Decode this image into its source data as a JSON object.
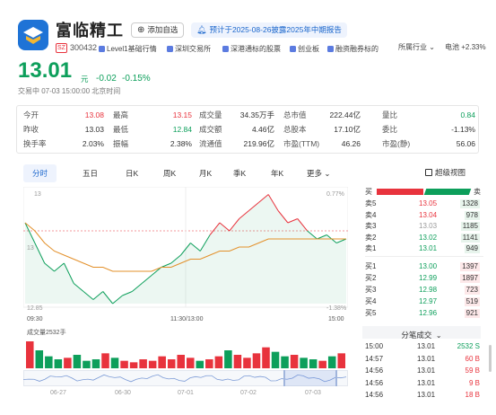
{
  "stock": {
    "name": "富临精工",
    "exchange_badge": "SZ",
    "code": "300432",
    "add_watchlist": "添加自选",
    "report_notice": "预计于2025-08-26披露2025年中期报告",
    "price": "13.01",
    "currency": "元",
    "change": "-0.02",
    "change_pct": "-0.15%",
    "status": "交易中 07-03 15:00:00 北京时间",
    "tags": [
      "Level1基础行情",
      "深圳交易所",
      "深港通标的股票",
      "创业板",
      "融资融券标的"
    ],
    "industry_label": "所属行业",
    "industry_value": "电池 +2.33%",
    "colors": {
      "up": "#e8333d",
      "down": "#0d9f5b",
      "brand": "#1a66cc"
    }
  },
  "stats": [
    [
      {
        "label": "今开",
        "value": "13.08",
        "color": "red"
      },
      {
        "label": "最高",
        "value": "13.15",
        "color": "red"
      },
      {
        "label": "成交量",
        "value": "34.35万手",
        "color": ""
      },
      {
        "label": "总市值",
        "value": "222.44亿",
        "color": ""
      },
      {
        "label": "量比",
        "value": "0.84",
        "color": "green"
      }
    ],
    [
      {
        "label": "昨收",
        "value": "13.03",
        "color": ""
      },
      {
        "label": "最低",
        "value": "12.84",
        "color": "green"
      },
      {
        "label": "成交额",
        "value": "4.46亿",
        "color": ""
      },
      {
        "label": "总股本",
        "value": "17.10亿",
        "color": ""
      },
      {
        "label": "委比",
        "value": "-1.13%",
        "color": ""
      }
    ],
    [
      {
        "label": "换手率",
        "value": "2.03%",
        "color": ""
      },
      {
        "label": "振幅",
        "value": "2.38%",
        "color": ""
      },
      {
        "label": "流通值",
        "value": "219.96亿",
        "color": ""
      },
      {
        "label": "市盈(TTM)",
        "value": "46.26",
        "color": ""
      },
      {
        "label": "市盈(静)",
        "value": "56.06",
        "color": ""
      }
    ]
  ],
  "chart_tabs": [
    "分时",
    "五日",
    "日K",
    "周K",
    "月K",
    "季K",
    "年K",
    "更多"
  ],
  "super_view": "超级视图",
  "chart_labels": {
    "y_top": "13",
    "y_mid": "13",
    "y_bot": "12.85",
    "pct_top": "0.77%",
    "pct_bot": "-1.38%",
    "x_start": "09:30",
    "x_mid": "11:30/13:00",
    "x_end": "15:00",
    "volume_label": "成交量2532手",
    "mini_dates": [
      "06-27",
      "06-30",
      "07-01",
      "07-02",
      "07-03"
    ]
  },
  "chart_data": {
    "type": "line",
    "series": [
      {
        "values": [
          13.05,
          13.0,
          12.95,
          12.93,
          12.95,
          12.9,
          12.88,
          12.86,
          12.88,
          12.85,
          12.87,
          12.88,
          12.9,
          12.92,
          12.94,
          12.95,
          12.97,
          13.0,
          12.98,
          13.02,
          13.05,
          13.03,
          13.06,
          13.08,
          13.1,
          13.12,
          13.08,
          13.05,
          13.06,
          13.03,
          13.01,
          13.02,
          13.0,
          13.01
        ]
      },
      {
        "values": [
          13.05,
          13.03,
          13.0,
          12.98,
          12.97,
          12.96,
          12.95,
          12.94,
          12.94,
          12.93,
          12.93,
          12.93,
          12.93,
          12.93,
          12.94,
          12.94,
          12.95,
          12.96,
          12.96,
          12.97,
          12.98,
          12.98,
          12.99,
          12.99,
          13.0,
          13.01,
          13.01,
          13.01,
          13.01,
          13.01,
          13.01,
          13.01,
          13.01,
          13.01
        ]
      }
    ],
    "ylim": [
      12.85,
      13.13
    ],
    "ref_line": 13.03,
    "volume": [
      18,
      12,
      8,
      6,
      7,
      9,
      5,
      6,
      10,
      7,
      5,
      4,
      6,
      5,
      8,
      6,
      9,
      7,
      5,
      6,
      8,
      12,
      9,
      7,
      10,
      14,
      11,
      8,
      9,
      7,
      6,
      5,
      8,
      10
    ]
  },
  "orderbook": {
    "buy_label": "买",
    "sell_label": "卖",
    "sells": [
      {
        "label": "卖5",
        "price": "13.05",
        "vol": "1328"
      },
      {
        "label": "卖4",
        "price": "13.04",
        "vol": "978"
      },
      {
        "label": "卖3",
        "price": "13.03",
        "vol": "1185"
      },
      {
        "label": "卖2",
        "price": "13.02",
        "vol": "1141"
      },
      {
        "label": "卖1",
        "price": "13.01",
        "vol": "949"
      }
    ],
    "buys": [
      {
        "label": "买1",
        "price": "13.00",
        "vol": "1397"
      },
      {
        "label": "买2",
        "price": "12.99",
        "vol": "1897"
      },
      {
        "label": "买3",
        "price": "12.98",
        "vol": "723"
      },
      {
        "label": "买4",
        "price": "12.97",
        "vol": "519"
      },
      {
        "label": "买5",
        "price": "12.96",
        "vol": "921"
      }
    ]
  },
  "trades": {
    "title": "分笔成交",
    "rows": [
      {
        "time": "15:00",
        "price": "13.01",
        "vol": "2532 S"
      },
      {
        "time": "14:57",
        "price": "13.01",
        "vol": "60 B"
      },
      {
        "time": "14:56",
        "price": "13.01",
        "vol": "59 B"
      },
      {
        "time": "14:56",
        "price": "13.01",
        "vol": "9 B"
      },
      {
        "time": "14:56",
        "price": "13.01",
        "vol": "18 B"
      }
    ]
  }
}
